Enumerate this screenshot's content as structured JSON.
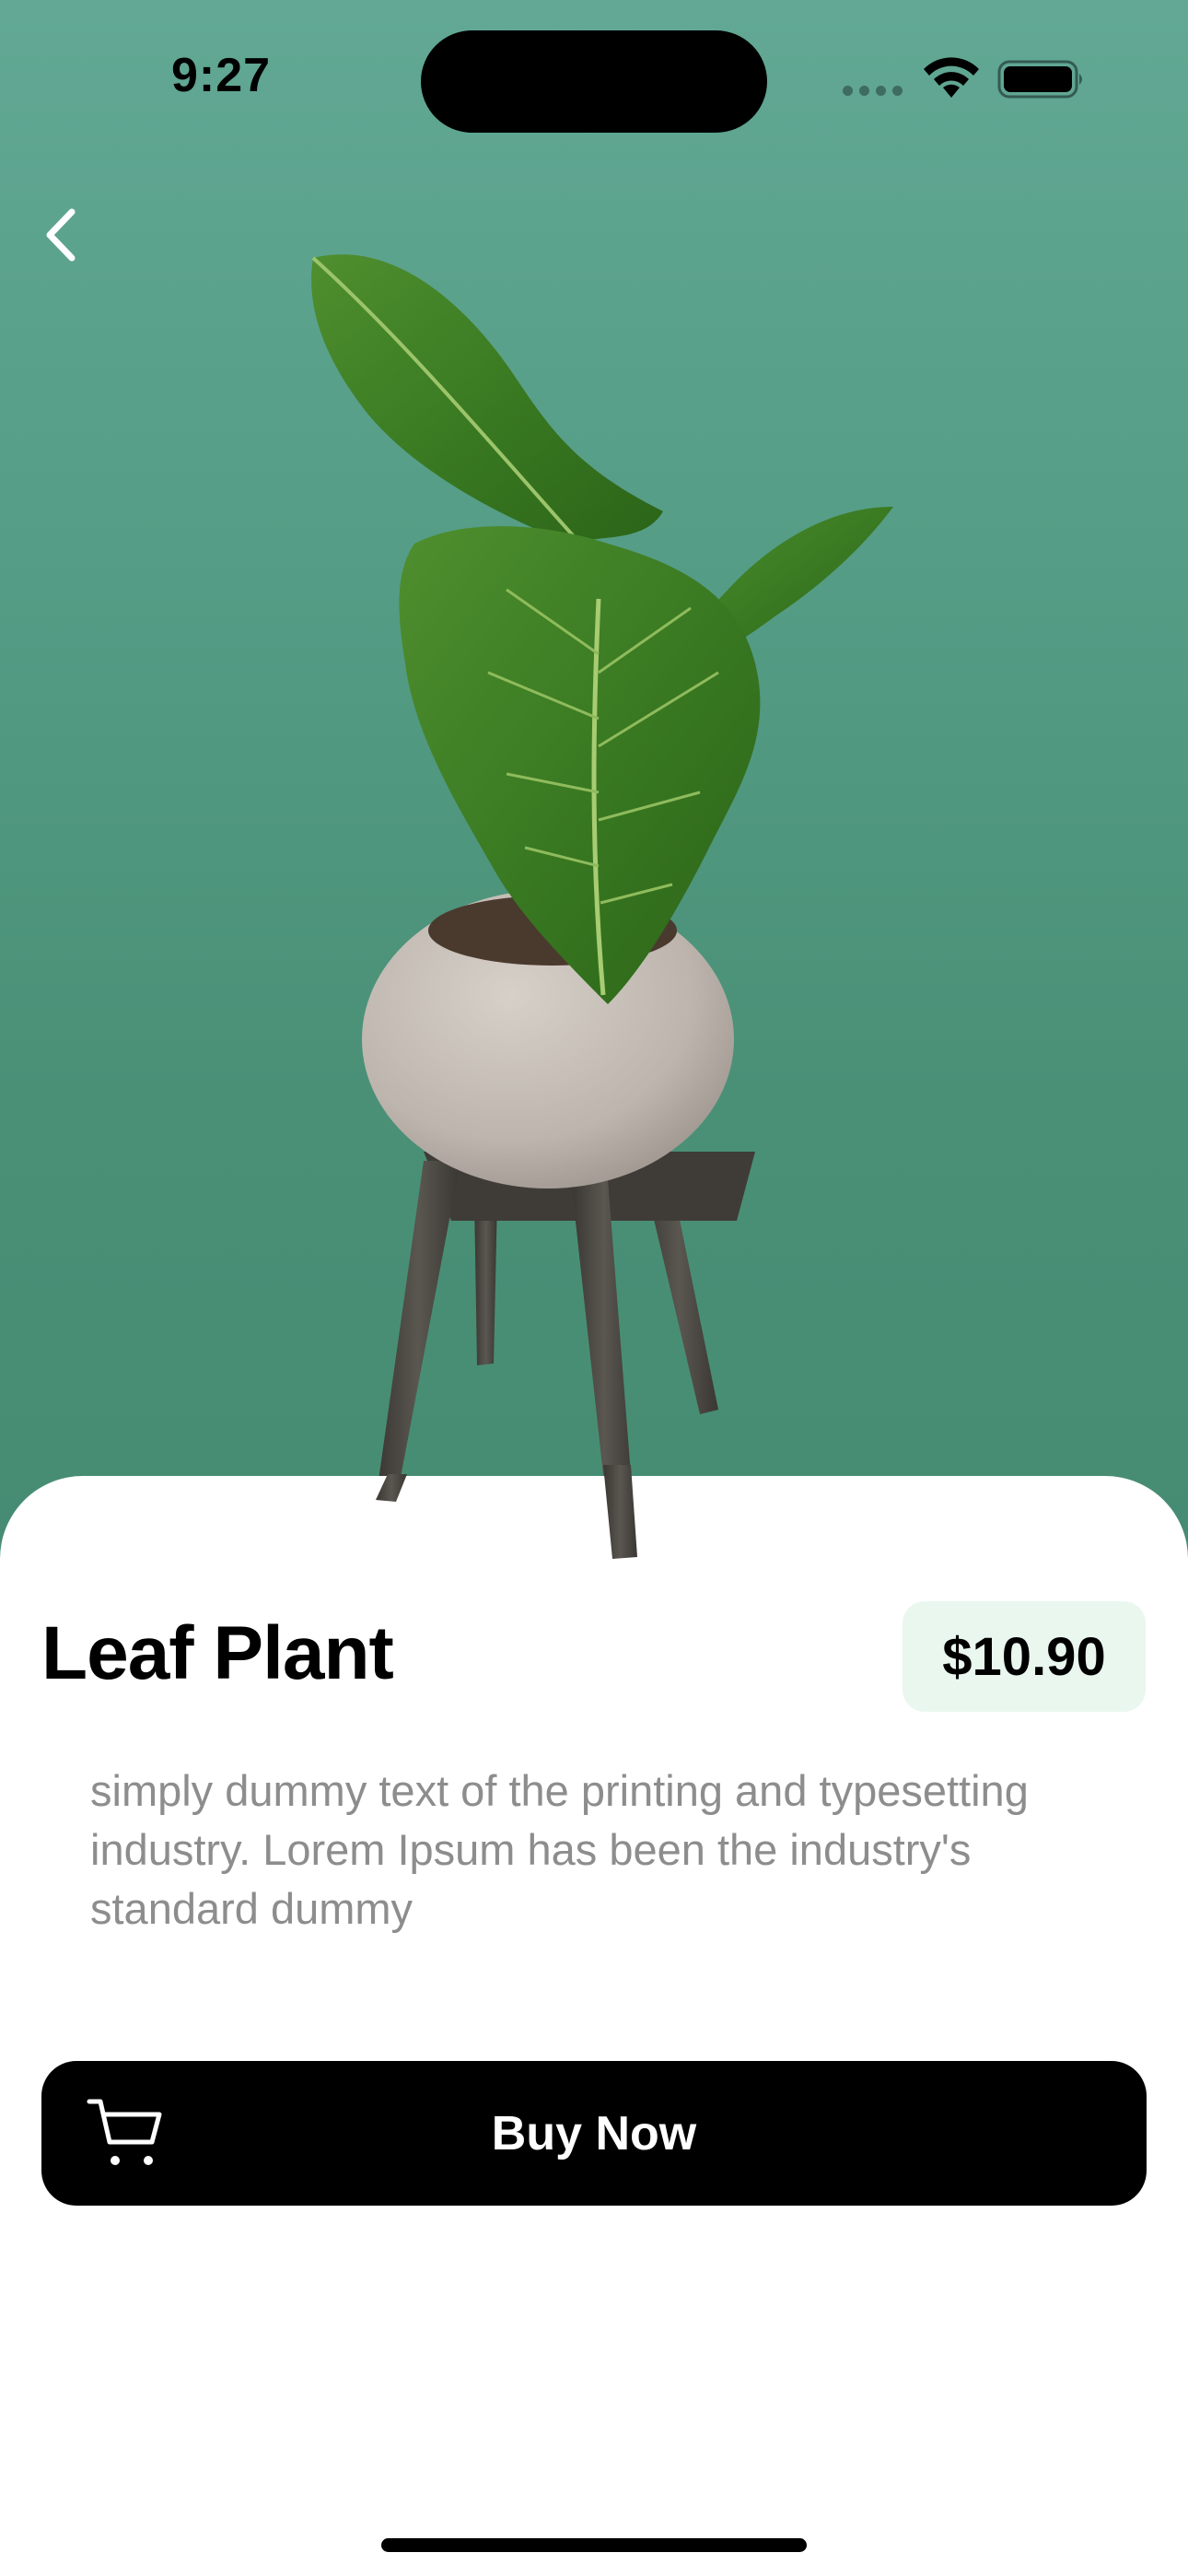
{
  "status_bar": {
    "time": "9:27",
    "icons": [
      "cellular-dots-icon",
      "wifi-icon",
      "battery-icon"
    ]
  },
  "navigation": {
    "back_icon": "chevron-left-icon"
  },
  "hero": {
    "image": "potted-leaf-plant-on-stand",
    "background_color": "#559d86"
  },
  "product": {
    "title": "Leaf Plant",
    "price": "$10.90",
    "price_badge_color": "#e9f7ee",
    "description": "simply dummy text of the printing and typesetting industry. Lorem Ipsum has been the industry's standard dummy"
  },
  "actions": {
    "buy_label": "Buy Now",
    "buy_icon": "cart-icon"
  }
}
